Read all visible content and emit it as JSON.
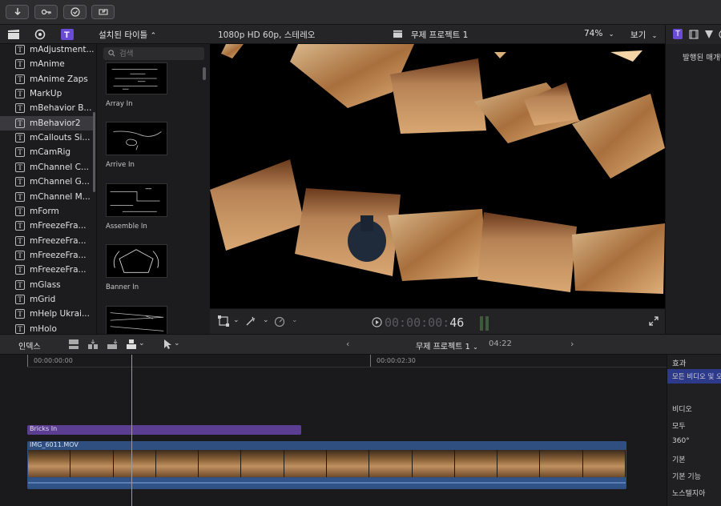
{
  "toolbar": {
    "buttons": [
      "import-icon",
      "keyword-icon",
      "checkmark-icon",
      "background-tasks-icon"
    ]
  },
  "browser": {
    "header_title": "설치된 타이틀",
    "header_icons": [
      "clapper-icon",
      "photos-icon",
      "titles-icon"
    ],
    "search_placeholder": "검색",
    "sidebar_items": [
      {
        "label": "mAdjustment..."
      },
      {
        "label": "mAnime"
      },
      {
        "label": "mAnime Zaps"
      },
      {
        "label": "MarkUp"
      },
      {
        "label": "mBehavior B..."
      },
      {
        "label": "mBehavior2",
        "selected": true
      },
      {
        "label": "mCallouts Si..."
      },
      {
        "label": "mCamRig"
      },
      {
        "label": "mChannel C..."
      },
      {
        "label": "mChannel G..."
      },
      {
        "label": "mChannel M..."
      },
      {
        "label": "mForm"
      },
      {
        "label": "mFreezeFra..."
      },
      {
        "label": "mFreezeFra..."
      },
      {
        "label": "mFreezeFra..."
      },
      {
        "label": "mFreezeFra..."
      },
      {
        "label": "mGlass"
      },
      {
        "label": "mGrid"
      },
      {
        "label": "mHelp Ukrai..."
      },
      {
        "label": "mHolo"
      }
    ],
    "gallery": [
      {
        "label": "Array In"
      },
      {
        "label": "Arrive In"
      },
      {
        "label": "Assemble In"
      },
      {
        "label": "Banner In"
      },
      {
        "label": ""
      }
    ]
  },
  "viewer": {
    "format": "1080p HD 60p, 스테레오",
    "project": "무제 프로젝트 1",
    "zoom": "74%",
    "view_menu": "보기",
    "timecode_dim": "00:00:00:",
    "timecode_hi": "46"
  },
  "inspector": {
    "text": "발행된 매개변"
  },
  "timeline": {
    "index_label": "인덱스",
    "project": "무제 프로젝트 1",
    "duration": "04:22",
    "ruler_start": "00:00:00:00",
    "ruler_mid": "00:00:02:30",
    "title_clip": "Bricks In",
    "video_clip": "IMG_6011.MOV"
  },
  "effects": {
    "title": "효과",
    "selected": "모든 비디오 및 오디오",
    "items": [
      "비디오",
      "모두",
      "360°",
      "기본",
      "기본 기능",
      "노스텔지아"
    ]
  },
  "colors": {
    "accent": "#5b3d92",
    "clip": "#2e4f7f",
    "selected": "#2d3a8a"
  }
}
